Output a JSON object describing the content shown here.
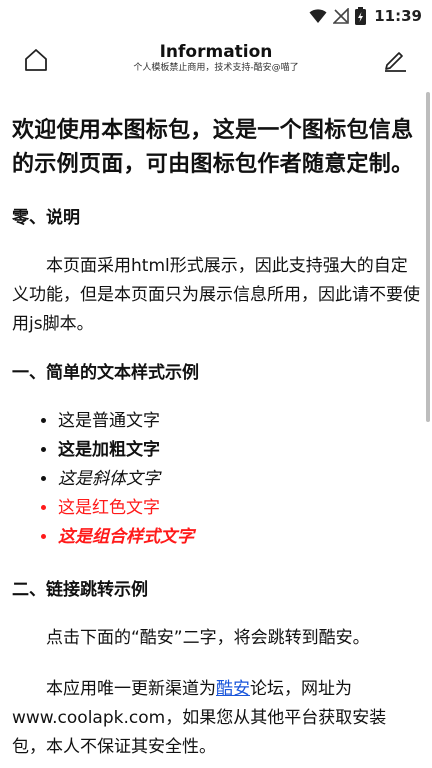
{
  "status_bar": {
    "time": "11:39"
  },
  "app_bar": {
    "title": "Information",
    "subtitle": "个人模板禁止商用，技术支持-酷安@喵了"
  },
  "content": {
    "heading": "欢迎使用本图标包，这是一个图标包信息的示例页面，可由图标包作者随意定制。",
    "section0": {
      "title": "零、说明",
      "paragraph": "本页面采用html形式展示，因此支持强大的自定义功能，但是本页面只为展示信息所用，因此请不要使用js脚本。"
    },
    "section1": {
      "title": "一、简单的文本样式示例",
      "items": {
        "normal": "这是普通文字",
        "bold": "这是加粗文字",
        "italic": "这是斜体文字",
        "red": "这是红色文字",
        "combo": "这是组合样式文字"
      }
    },
    "section2": {
      "title": "二、链接跳转示例",
      "paragraph1": "点击下面的“酷安”二字，将会跳转到酷安。",
      "p2_before": "本应用唯一更新渠道为",
      "p2_link": "酷安",
      "p2_after": "论坛，网址为www.coolapk.com，如果您从其他平台获取安装包，本人不保证其安全性。"
    }
  },
  "colors": {
    "accent_red": "#ff1a1a",
    "link_blue": "#1a56db"
  },
  "icons": {
    "home": "home-outline-icon",
    "edit": "pencil-icon",
    "wifi": "wifi-icon",
    "signal": "no-signal-icon",
    "battery": "battery-icon"
  }
}
